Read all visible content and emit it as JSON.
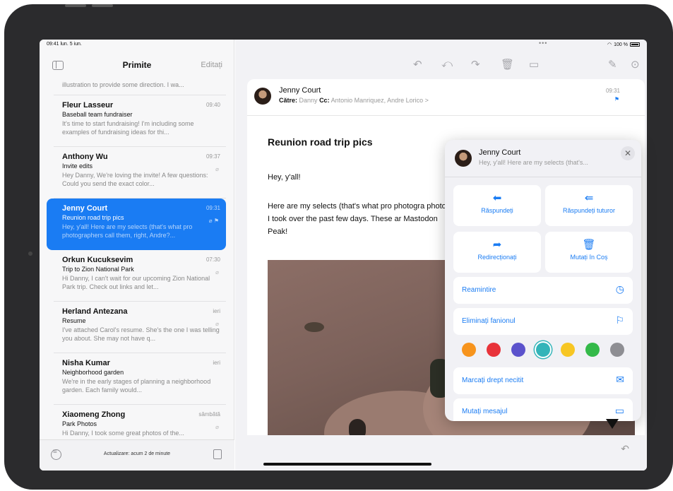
{
  "status": {
    "time": "09:41",
    "date": "lun. 5 iun.",
    "dots": "•••",
    "battery": "100 %"
  },
  "sidebar": {
    "title": "Primite",
    "edit": "Editați",
    "top_snippet": "illustration to provide some direction. I wa...",
    "items": [
      {
        "name": "Fleur Lasseur",
        "time": "09:40",
        "subject": "Baseball team fundraiser",
        "preview": "It's time to start fundraising! I'm including some examples of fundraising ideas for thi...",
        "attachment": ""
      },
      {
        "name": "Anthony Wu",
        "time": "09:37",
        "subject": "Invite edits",
        "preview": "Hey Danny, We're loving the invite! A few questions: Could you send the exact color...",
        "attachment": "⌀"
      },
      {
        "name": "Jenny Court",
        "time": "09:31",
        "subject": "Reunion road trip pics",
        "preview": "Hey, y'all! Here are my selects (that's what pro photographers call them, right, Andre?...",
        "attachment": "⌀ ⚑"
      },
      {
        "name": "Orkun Kucuksevim",
        "time": "07:30",
        "subject": "Trip to Zion National Park",
        "preview": "Hi Danny, I can't wait for our upcoming Zion National Park trip. Check out links and let...",
        "attachment": "⌀"
      },
      {
        "name": "Herland Antezana",
        "time": "ieri",
        "subject": "Resume",
        "preview": "I've attached Carol's resume. She's the one I was telling you about. She may not have q...",
        "attachment": "⌀"
      },
      {
        "name": "Nisha Kumar",
        "time": "ieri",
        "subject": "Neighborhood garden",
        "preview": "We're in the early stages of planning a neighborhood garden. Each family would...",
        "attachment": ""
      },
      {
        "name": "Xiaomeng Zhong",
        "time": "sâmbătă",
        "subject": "Park Photos",
        "preview": "Hi Danny, I took some great photos of the...",
        "attachment": "⌀"
      }
    ],
    "update": "Actualizare: acum 2 de minute"
  },
  "message": {
    "from": "Jenny Court",
    "to_label": "Către:",
    "to": "Danny",
    "cc_label": "Cc:",
    "cc": "Antonio Manriquez, Andre Lorico >",
    "time": "09:31",
    "subject": "Reunion road trip pics",
    "greeting": "Hey, y'all!",
    "body": "Here are my selects (that's what pro photogra photos I took over the past few days. These ar Mastodon Peak!"
  },
  "popover": {
    "name": "Jenny Court",
    "preview": "Hey, y'all! Here are my selects (that's...",
    "actions": {
      "reply": "Răspundeți",
      "reply_all": "Răspundeți tuturor",
      "forward": "Redirecționați",
      "trash": "Mutați în Coș"
    },
    "rows": {
      "remind": "Reamintire",
      "unflag": "Eliminați fanionul",
      "mark_unread": "Marcați drept necitit",
      "move": "Mutați mesajul"
    },
    "flag_colors": [
      "#f7941d",
      "#e8333a",
      "#5b52cc",
      "#33b4b9",
      "#f7c623",
      "#34b949",
      "#8e8e93"
    ]
  }
}
